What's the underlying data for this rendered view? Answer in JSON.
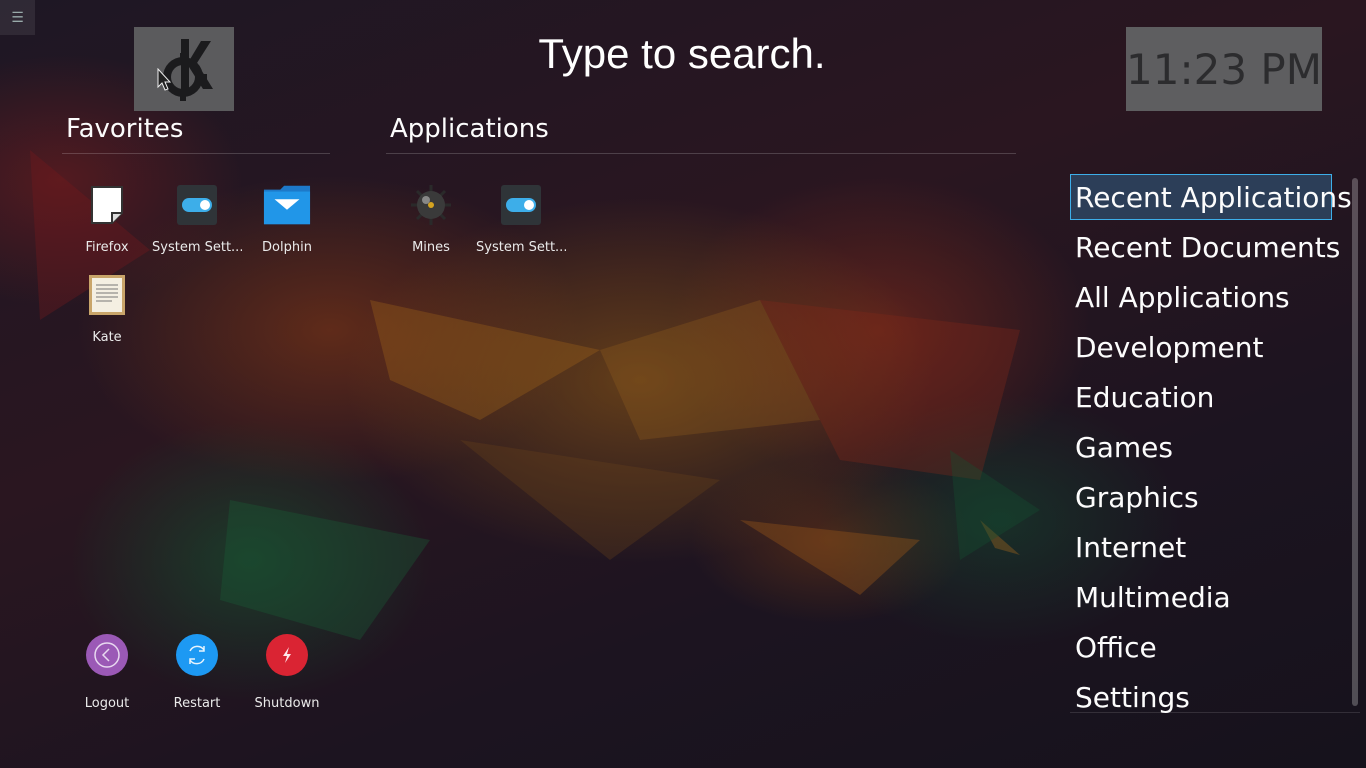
{
  "search": {
    "prompt": "Type to search."
  },
  "clock": {
    "time": "11:23 PM"
  },
  "favorites": {
    "title": "Favorites",
    "items": [
      {
        "label": "Firefox",
        "icon": "document-icon"
      },
      {
        "label": "System Sett...",
        "icon": "toggle-switch-icon"
      },
      {
        "label": "Dolphin",
        "icon": "folder-mail-icon"
      },
      {
        "label": "Kate",
        "icon": "text-editor-icon"
      }
    ]
  },
  "applications": {
    "title": "Applications",
    "items": [
      {
        "label": "Mines",
        "icon": "mine-icon"
      },
      {
        "label": "System Sett...",
        "icon": "toggle-switch-icon"
      }
    ]
  },
  "categories": {
    "selected": "Recent Applications",
    "items": [
      "Recent Applications",
      "Recent Documents",
      "All Applications",
      "Development",
      "Education",
      "Games",
      "Graphics",
      "Internet",
      "Multimedia",
      "Office",
      "Settings"
    ]
  },
  "power": {
    "logout": "Logout",
    "restart": "Restart",
    "shutdown": "Shutdown"
  },
  "colors": {
    "accent": "#3daee9",
    "logout": "#9b59b6",
    "restart": "#1d99f3",
    "shutdown": "#da2433"
  }
}
